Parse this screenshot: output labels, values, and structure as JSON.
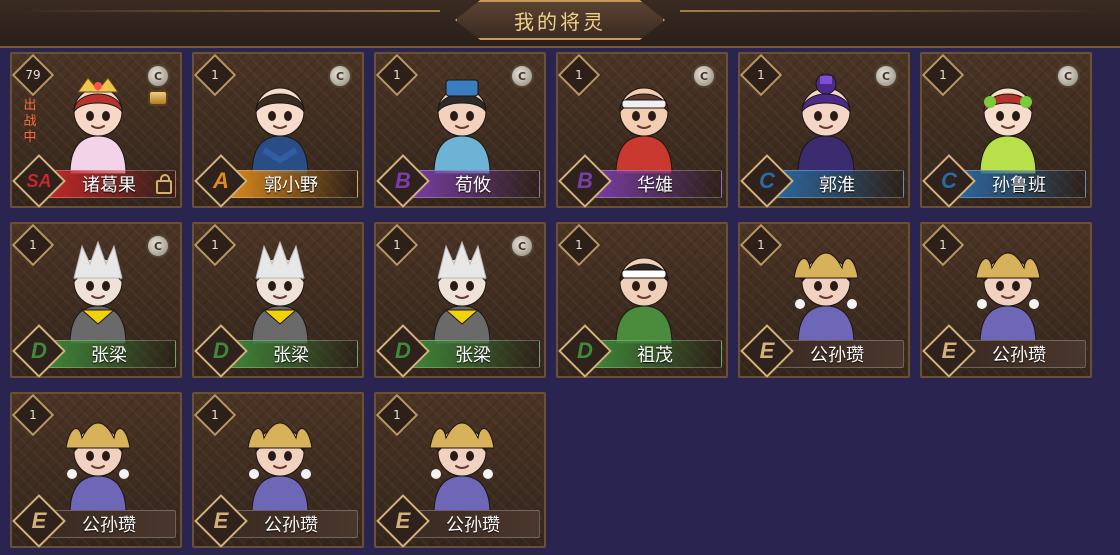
{
  "header": {
    "title": "我的将灵"
  },
  "status_deployed": "出战中",
  "cards": [
    {
      "level": "79",
      "grade": "SA",
      "name": "诸葛果",
      "deployed": true,
      "locked": true,
      "coin": true,
      "coin2": true,
      "style": "zhuge"
    },
    {
      "level": "1",
      "grade": "A",
      "name": "郭小野",
      "coin": true,
      "style": "guo"
    },
    {
      "level": "1",
      "grade": "B",
      "name": "荀攸",
      "coin": true,
      "style": "xun"
    },
    {
      "level": "1",
      "grade": "B",
      "name": "华雄",
      "coin": true,
      "style": "hua"
    },
    {
      "level": "1",
      "grade": "C",
      "name": "郭淮",
      "coin": true,
      "style": "guohuai"
    },
    {
      "level": "1",
      "grade": "C",
      "name": "孙鲁班",
      "coin": true,
      "style": "sun"
    },
    {
      "level": "1",
      "grade": "D",
      "name": "张梁",
      "coin": true,
      "style": "zhang"
    },
    {
      "level": "1",
      "grade": "D",
      "name": "张梁",
      "coin": false,
      "style": "zhang"
    },
    {
      "level": "1",
      "grade": "D",
      "name": "张梁",
      "coin": true,
      "style": "zhang"
    },
    {
      "level": "1",
      "grade": "D",
      "name": "祖茂",
      "coin": false,
      "style": "zumao"
    },
    {
      "level": "1",
      "grade": "E",
      "name": "公孙瓒",
      "coin": false,
      "style": "gongsun"
    },
    {
      "level": "1",
      "grade": "E",
      "name": "公孙瓒",
      "coin": false,
      "style": "gongsun"
    },
    {
      "level": "1",
      "grade": "E",
      "name": "公孙瓒",
      "coin": false,
      "style": "gongsun"
    },
    {
      "level": "1",
      "grade": "E",
      "name": "公孙瓒",
      "coin": false,
      "style": "gongsun"
    },
    {
      "level": "1",
      "grade": "E",
      "name": "公孙瓒",
      "coin": false,
      "style": "gongsun"
    }
  ],
  "colors": {
    "bg": "#2a2550",
    "grade_SA": "#c8282a",
    "grade_A": "#e08c1c",
    "grade_B": "#7a3ea8",
    "grade_C": "#2a6aa6",
    "grade_D": "#3f8a3a",
    "grade_E": "#3a2a22"
  },
  "icons": {
    "coin": "c-coin-icon",
    "lock": "lock-icon"
  }
}
